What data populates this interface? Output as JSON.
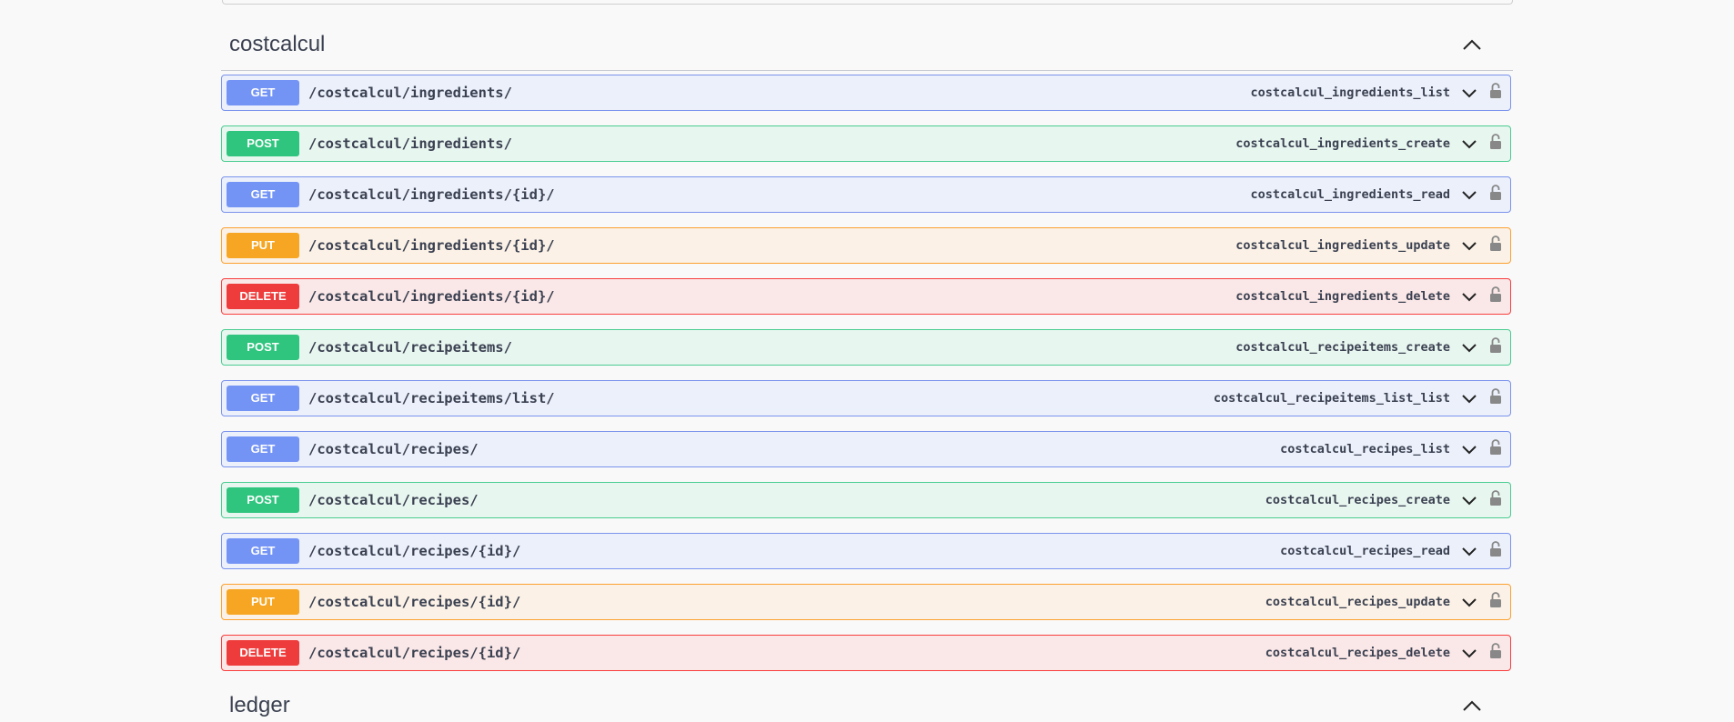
{
  "sections": [
    {
      "title": "costcalcul",
      "operations": [
        {
          "method": "GET",
          "path": "/costcalcul/ingredients/",
          "operation_id": "costcalcul_ingredients_list"
        },
        {
          "method": "POST",
          "path": "/costcalcul/ingredients/",
          "operation_id": "costcalcul_ingredients_create"
        },
        {
          "method": "GET",
          "path": "/costcalcul/ingredients/{id}/",
          "operation_id": "costcalcul_ingredients_read"
        },
        {
          "method": "PUT",
          "path": "/costcalcul/ingredients/{id}/",
          "operation_id": "costcalcul_ingredients_update"
        },
        {
          "method": "DELETE",
          "path": "/costcalcul/ingredients/{id}/",
          "operation_id": "costcalcul_ingredients_delete"
        },
        {
          "method": "POST",
          "path": "/costcalcul/recipeitems/",
          "operation_id": "costcalcul_recipeitems_create"
        },
        {
          "method": "GET",
          "path": "/costcalcul/recipeitems/list/",
          "operation_id": "costcalcul_recipeitems_list_list"
        },
        {
          "method": "GET",
          "path": "/costcalcul/recipes/",
          "operation_id": "costcalcul_recipes_list"
        },
        {
          "method": "POST",
          "path": "/costcalcul/recipes/",
          "operation_id": "costcalcul_recipes_create"
        },
        {
          "method": "GET",
          "path": "/costcalcul/recipes/{id}/",
          "operation_id": "costcalcul_recipes_read"
        },
        {
          "method": "PUT",
          "path": "/costcalcul/recipes/{id}/",
          "operation_id": "costcalcul_recipes_update"
        },
        {
          "method": "DELETE",
          "path": "/costcalcul/recipes/{id}/",
          "operation_id": "costcalcul_recipes_delete"
        }
      ]
    },
    {
      "title": "ledger",
      "operations": []
    }
  ],
  "icons": {
    "section_toggle": "chevron-up-icon",
    "operation_expand": "chevron-down-icon",
    "authorization": "lock-icon"
  },
  "colors": {
    "get": "#7494f5",
    "post": "#2fc57e",
    "put": "#f6a622",
    "delete": "#ee3b3b",
    "text": "#3b4151"
  }
}
